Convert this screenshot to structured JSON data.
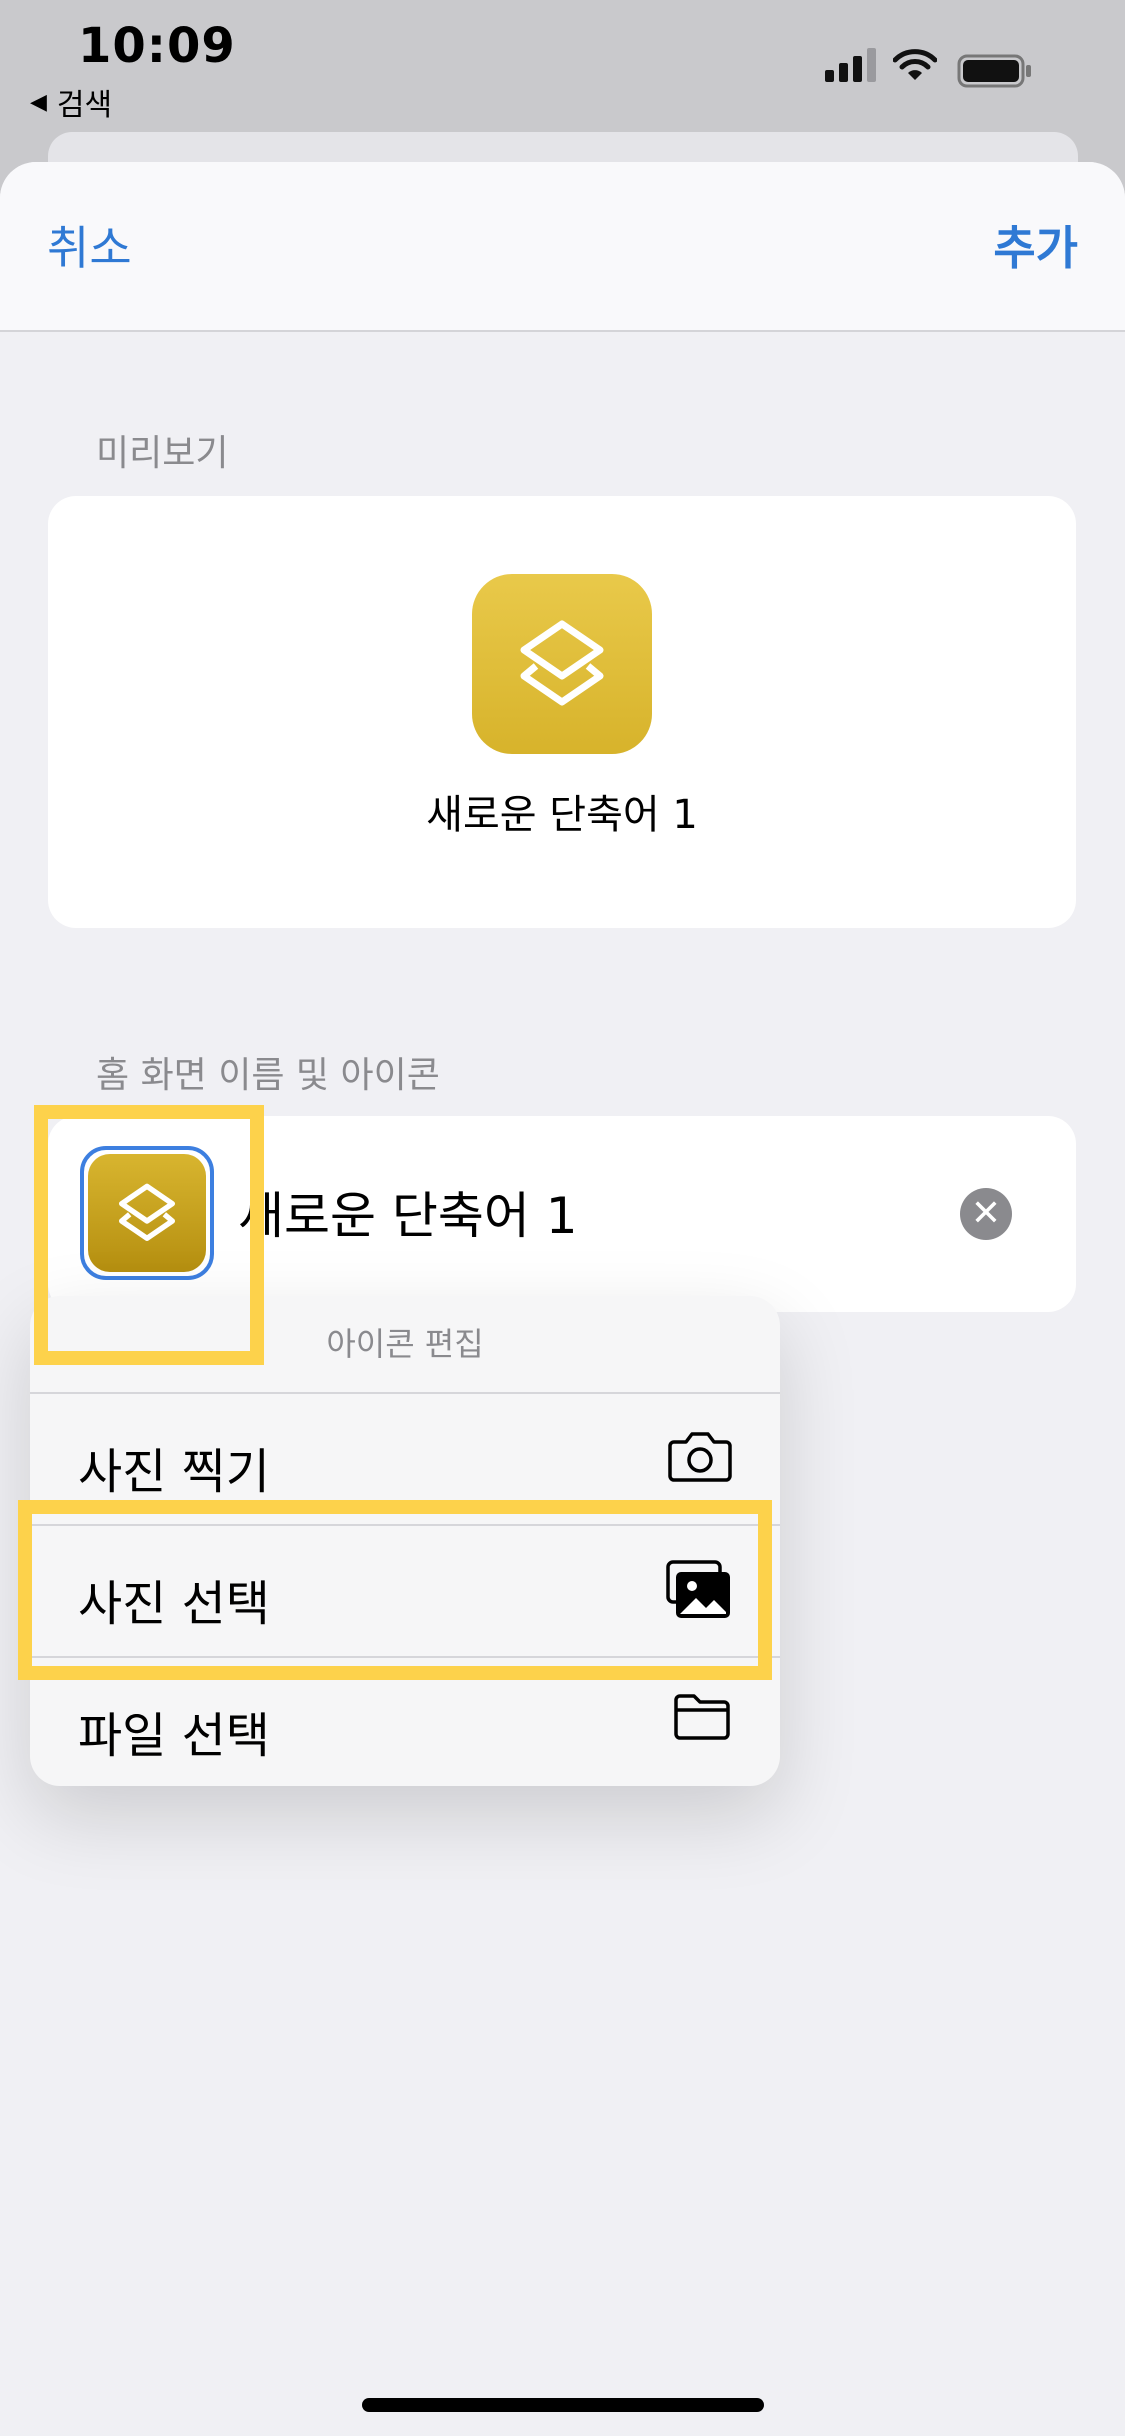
{
  "status_bar": {
    "time": "10:09",
    "back_label": "검색",
    "back_arrow": "◀",
    "icons": [
      "cellular-signal-icon",
      "wifi-icon",
      "battery-icon"
    ]
  },
  "nav": {
    "cancel_label": "취소",
    "add_label": "추가"
  },
  "preview": {
    "section_label": "미리보기",
    "icon": "shortcuts-layers-icon",
    "name": "새로운 단축어 1"
  },
  "home_screen": {
    "section_label": "홈 화면 이름 및 아이콘",
    "name_value": "새로운 단축어 1",
    "clear_glyph": "✕"
  },
  "icon_menu": {
    "title": "아이콘 편집",
    "items": [
      {
        "label": "사진 찍기",
        "icon": "camera-icon"
      },
      {
        "label": "사진 선택",
        "icon": "photo-library-icon"
      },
      {
        "label": "파일 선택",
        "icon": "folder-icon"
      }
    ]
  },
  "colors": {
    "accent": "#2f79d4",
    "icon_yellow": "#e2c03e",
    "highlight": "#fdd24b"
  }
}
